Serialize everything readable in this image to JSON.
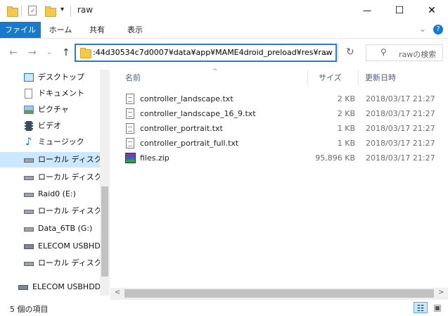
{
  "window": {
    "title": "raw",
    "minimize_glyph": "—",
    "maximize_glyph": "☐",
    "close_glyph": "✕",
    "quick_access_dropdown": "▾",
    "help_glyph": "?",
    "expand_ribbon_glyph": "⌄"
  },
  "ribbon": {
    "tabs": [
      "ファイル",
      "ホーム",
      "共有",
      "表示"
    ]
  },
  "navigation": {
    "back_glyph": "←",
    "forward_glyph": "→",
    "recent_glyph": "⌄",
    "up_glyph": "↑",
    "address": ":44d30534c7d0007¥data¥app¥MAME4droid_preload¥res¥raw",
    "address_dropdown_glyph": "⌄",
    "refresh_glyph": "↻",
    "search_glyph": "⚲",
    "search_placeholder": "rawの検索"
  },
  "sidebar": {
    "items": [
      {
        "label": "デスクトップ",
        "icon": "desktop-icon"
      },
      {
        "label": "ドキュメント",
        "icon": "documents-icon"
      },
      {
        "label": "ピクチャ",
        "icon": "pictures-icon"
      },
      {
        "label": "ビデオ",
        "icon": "videos-icon"
      },
      {
        "label": "ミュージック",
        "icon": "music-icon"
      },
      {
        "label": "ローカル ディスク (C",
        "icon": "drive-icon",
        "selected": true
      },
      {
        "label": "ローカル ディスク (D",
        "icon": "drive-icon"
      },
      {
        "label": "Raid0 (E:)",
        "icon": "drive-icon"
      },
      {
        "label": "ローカル ディスク (F",
        "icon": "drive-icon"
      },
      {
        "label": "Data_6TB (G:)",
        "icon": "drive-icon"
      },
      {
        "label": "ELECOM USBHD",
        "icon": "usb-drive-icon"
      },
      {
        "label": "ローカル ディスク (I:",
        "icon": "drive-icon"
      },
      {
        "label": "ELECOM USBHDD",
        "icon": "usb-drive-icon"
      }
    ]
  },
  "file_list": {
    "columns": [
      "名前",
      "サイズ",
      "更新日時"
    ],
    "sort_glyph": "^",
    "rows": [
      {
        "name": "controller_landscape.txt",
        "size": "2 KB",
        "modified": "2018/03/17 21:27",
        "type": "text"
      },
      {
        "name": "controller_landscape_16_9.txt",
        "size": "2 KB",
        "modified": "2018/03/17 21:27",
        "type": "text"
      },
      {
        "name": "controller_portrait.txt",
        "size": "1 KB",
        "modified": "2018/03/17 21:27",
        "type": "text"
      },
      {
        "name": "controller_portrait_full.txt",
        "size": "1 KB",
        "modified": "2018/03/17 21:27",
        "type": "text"
      },
      {
        "name": "files.zip",
        "size": "95,896 KB",
        "modified": "2018/03/17 21:27",
        "type": "zip"
      }
    ]
  },
  "status": {
    "item_count": "5 個の項目",
    "details_view_glyph": "☷",
    "large_icons_glyph": "▣"
  },
  "scroll": {
    "left_glyph": "<",
    "right_glyph": ">"
  },
  "colors": {
    "accent": "#1979ca",
    "selection": "#cce8ff",
    "address_border": "#2b7bd6"
  }
}
